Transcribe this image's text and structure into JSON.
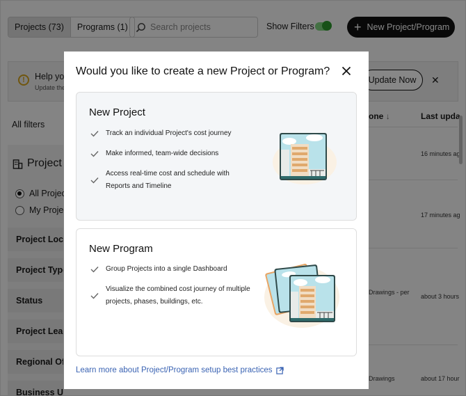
{
  "toolbar": {
    "tab_projects": "Projects (73)",
    "tab_programs": "Programs (1)",
    "search_placeholder": "Search projects",
    "show_filters_label": "Show Filters",
    "new_button_label": "New Project/Program"
  },
  "banner": {
    "line1": "Help yo",
    "line2": "Update the",
    "update_button": "Update Now"
  },
  "filters": {
    "all_filters": "All filters",
    "project_title": "Project",
    "radio_all": "All Projec",
    "radio_my": "My Projec",
    "items": [
      "Project Loca",
      "Project Type",
      "Status",
      "Project Lead",
      "Regional Offi",
      "Business Unit"
    ]
  },
  "table": {
    "col_milestone": "one",
    "col_last_updated": "Last upda",
    "rows": [
      {
        "milestone": "",
        "updated": "16 minutes ag"
      },
      {
        "milestone": "",
        "updated": "17 minutes ag"
      },
      {
        "milestone": "Drawings - per",
        "updated": "about 3 hours"
      },
      {
        "milestone": "Drawings",
        "updated": "about 17 hour"
      }
    ]
  },
  "modal": {
    "title": "Would you like to create a new Project or Program?",
    "project": {
      "heading": "New Project",
      "features": [
        "Track an individual Project's cost journey",
        "Make informed, team-wide decisions",
        "Access real-time cost and schedule with Reports and Timeline"
      ]
    },
    "program": {
      "heading": "New Program",
      "features": [
        "Group Projects into a single Dashboard",
        "Visualize the combined cost journey of multiple projects, phases, buildings, etc."
      ]
    },
    "learn_more": "Learn more about Project/Program setup best practices"
  },
  "colors": {
    "link": "#3a63b3",
    "toggle_on": "#2c9a2c",
    "warning": "#d4a21c",
    "card_tint": "#f4f6f8"
  }
}
